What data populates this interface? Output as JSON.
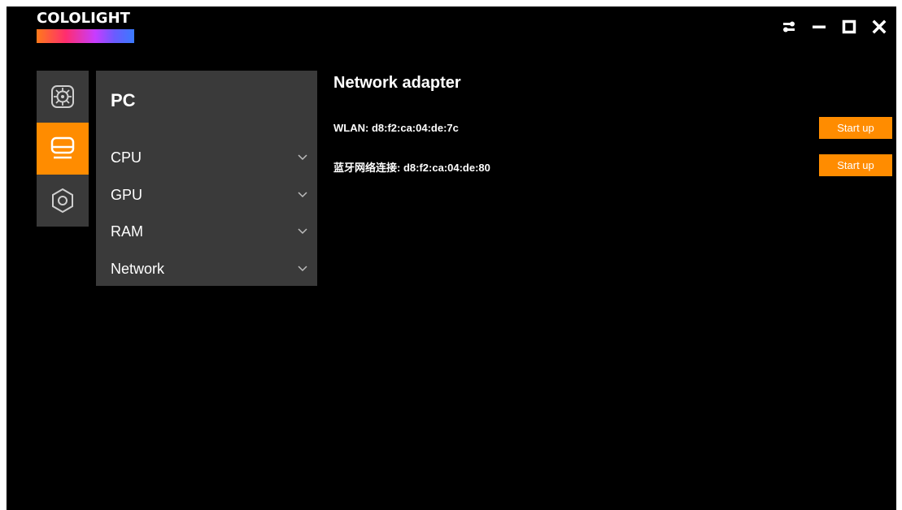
{
  "app": {
    "logo_text": "COLOLIGHT"
  },
  "titlebar": {
    "icons": [
      "swap-arrows-icon",
      "minimize-icon",
      "maximize-icon",
      "close-icon"
    ]
  },
  "rail": {
    "items": [
      {
        "icon": "light-panel-icon",
        "active": false
      },
      {
        "icon": "monitor-icon",
        "active": true
      },
      {
        "icon": "settings-hexagon-icon",
        "active": false
      }
    ]
  },
  "menu": {
    "title": "PC",
    "items": [
      {
        "label": "CPU"
      },
      {
        "label": "GPU"
      },
      {
        "label": "RAM"
      },
      {
        "label": "Network"
      }
    ]
  },
  "content": {
    "title": "Network adapter",
    "adapters": [
      {
        "name": "WLAN:",
        "mac": "d8:f2:ca:04:de:7c",
        "button": "Start up"
      },
      {
        "name": "蓝牙网络连接:",
        "mac": "d8:f2:ca:04:de:80",
        "button": "Start up"
      }
    ]
  },
  "colors": {
    "accent": "#ff8c00",
    "panel": "#3a3a3a",
    "background": "#000000"
  }
}
